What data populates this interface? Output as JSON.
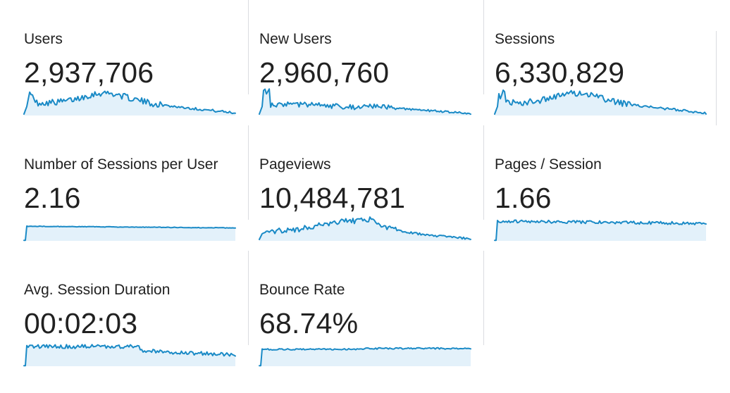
{
  "colors": {
    "line": "#1a8ac6",
    "fill": "#e3f1fa",
    "divider": "#dadce0",
    "text": "#212121"
  },
  "metrics": [
    {
      "label": "Users",
      "value": "2,937,706",
      "shape": "rise-peak-decline"
    },
    {
      "label": "New Users",
      "value": "2,960,760",
      "shape": "rise-flat-decline"
    },
    {
      "label": "Sessions",
      "value": "6,330,829",
      "shape": "rise-peak-decline"
    },
    {
      "label": "Number of Sessions per User",
      "value": "2.16",
      "shape": "flat-high"
    },
    {
      "label": "Pageviews",
      "value": "10,484,781",
      "shape": "rise-peak-late-decline"
    },
    {
      "label": "Pages / Session",
      "value": "1.66",
      "shape": "flat-high-noisy"
    },
    {
      "label": "Avg. Session Duration",
      "value": "00:02:03",
      "shape": "step-down"
    },
    {
      "label": "Bounce Rate",
      "value": "68.74%",
      "shape": "flat-mid"
    }
  ]
}
